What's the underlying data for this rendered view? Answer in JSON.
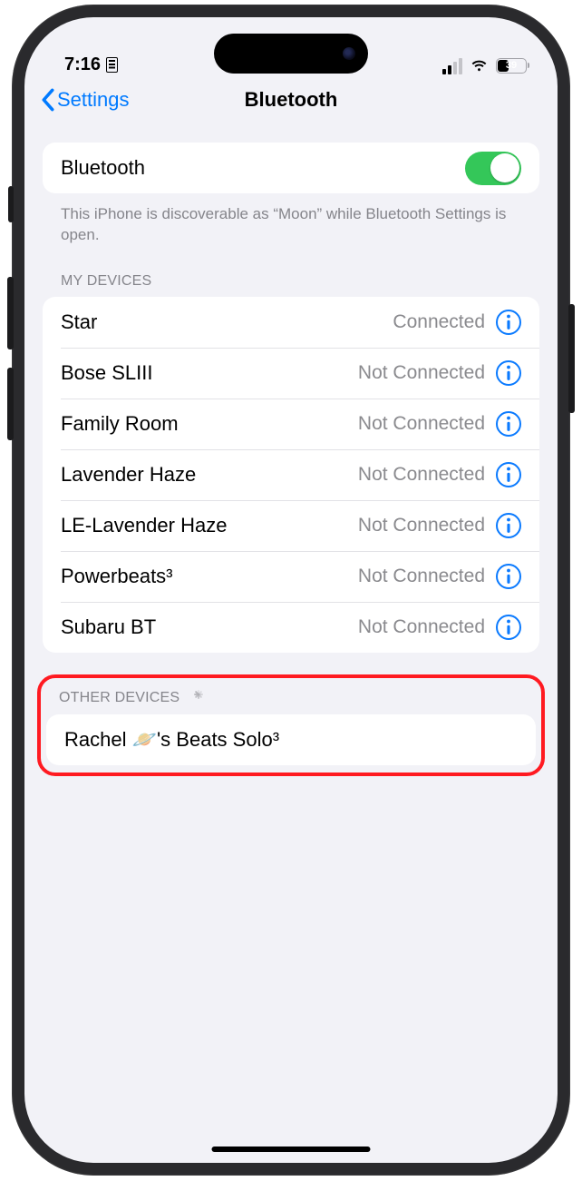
{
  "status_bar": {
    "time": "7:16",
    "battery_pct": "39"
  },
  "nav": {
    "back_label": "Settings",
    "title": "Bluetooth"
  },
  "bluetooth_row": {
    "label": "Bluetooth"
  },
  "discoverable_text": "This iPhone is discoverable as “Moon” while Bluetooth Settings is open.",
  "sections": {
    "my_devices_header": "MY DEVICES",
    "other_devices_header": "OTHER DEVICES"
  },
  "my_devices": [
    {
      "name": "Star",
      "status": "Connected"
    },
    {
      "name": "Bose SLIII",
      "status": "Not Connected"
    },
    {
      "name": "Family Room",
      "status": "Not Connected"
    },
    {
      "name": "Lavender Haze",
      "status": "Not Connected"
    },
    {
      "name": "LE-Lavender Haze",
      "status": "Not Connected"
    },
    {
      "name": "Powerbeats³",
      "status": "Not Connected"
    },
    {
      "name": "Subaru BT",
      "status": "Not Connected"
    }
  ],
  "other_devices": [
    {
      "name": "Rachel 🪐's Beats Solo³"
    }
  ]
}
